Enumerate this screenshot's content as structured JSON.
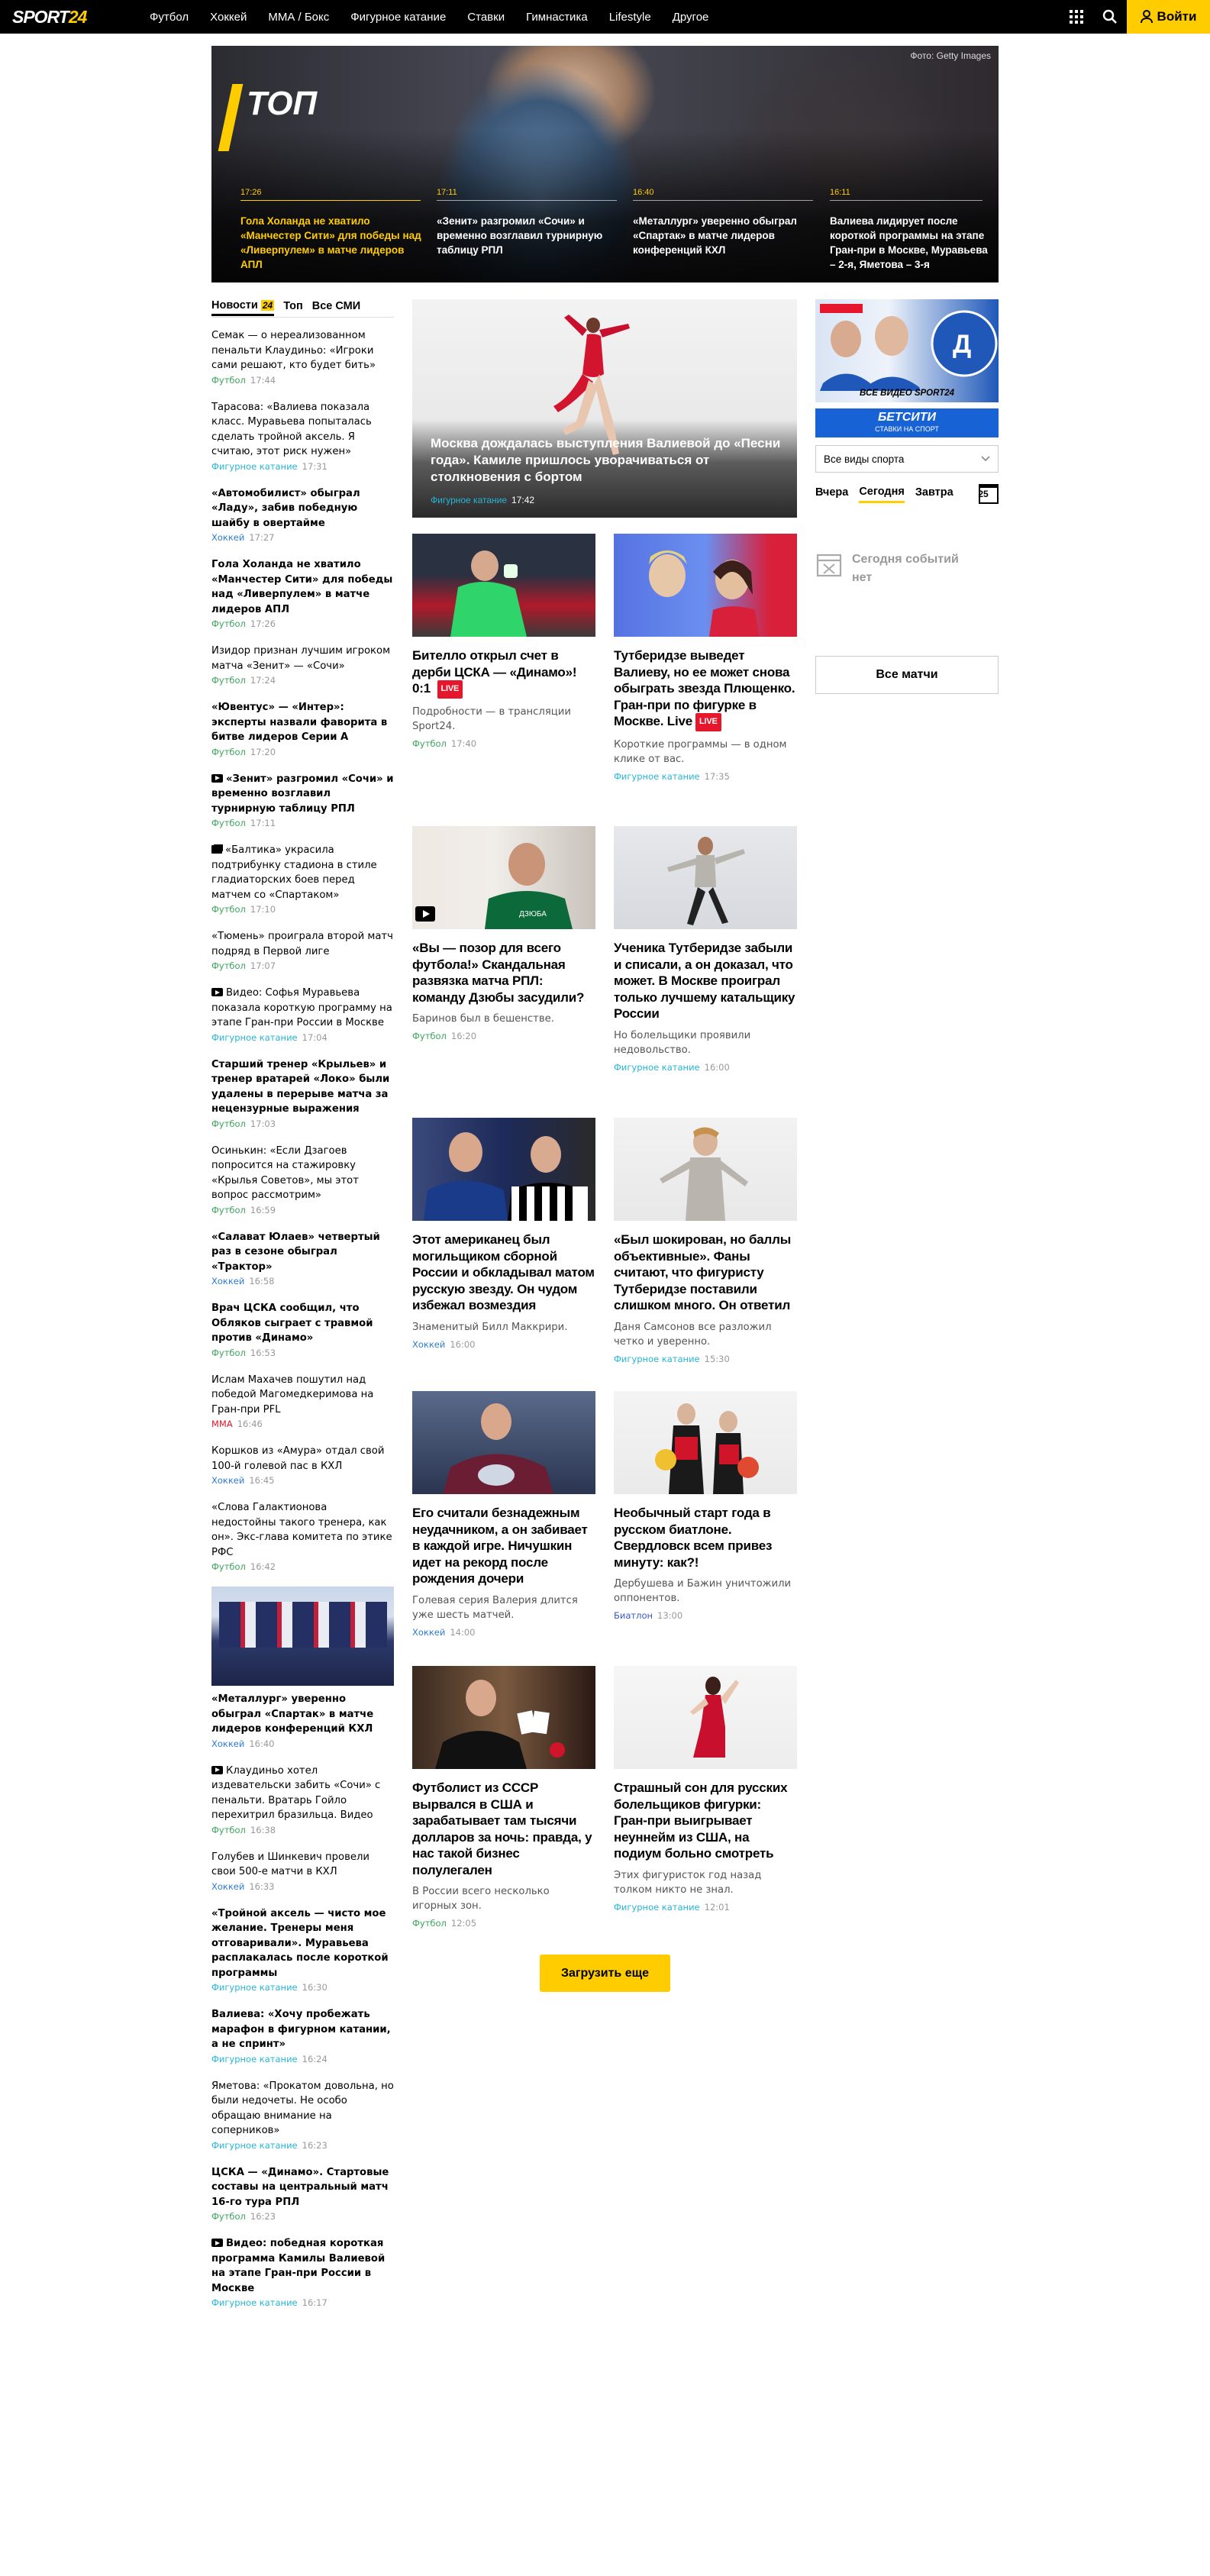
{
  "header": {
    "logo": "SPORT24",
    "nav": [
      "Футбол",
      "Хоккей",
      "ММА / Бокс",
      "Фигурное катание",
      "Ставки",
      "Гимнастика",
      "Lifestyle",
      "Другое"
    ],
    "login": "Войти"
  },
  "colors": {
    "accent": "#ffcc00",
    "football": "#3da35d",
    "hockey": "#2e7bd6",
    "figure": "#27b5d5",
    "mma": "#e6162d",
    "biathlon": "#3858c8"
  },
  "top": {
    "credit": "Фото: Getty Images",
    "title": "ТОП",
    "items": [
      {
        "time": "17:26",
        "title": "Гола Холанда не хватило «Манчестер Сити» для победы над «Ливерпулем» в матче лидеров АПЛ"
      },
      {
        "time": "17:11",
        "title": "«Зенит» разгромил «Сочи» и временно возглавил турнирную таблицу РПЛ"
      },
      {
        "time": "16:40",
        "title": "«Металлург» уверенно обыграл «Спартак» в матче лидеров конференций КХЛ"
      },
      {
        "time": "16:11",
        "title": "Валиева лидирует после короткой программы на этапе Гран-при в Москве, Муравьева – 2-я, Яметова – 3-я"
      }
    ]
  },
  "left": {
    "tabs": [
      "Новости",
      "Топ",
      "Все СМИ"
    ],
    "news": [
      {
        "title": "Семак — о нереализованном пенальти Клаудиньо: «Игроки сами решают, кто будет бить»",
        "cat": "Футбол",
        "time": "17:44",
        "bold": false
      },
      {
        "title": "Тарасова: «Валиева показала класс. Муравьева попыталась сделать тройной аксель. Я считаю, этот риск нужен»",
        "cat": "Фигурное катание",
        "time": "17:31",
        "bold": false
      },
      {
        "title": "«Автомобилист» обыграл «Ладу», забив победную шайбу в овертайме",
        "cat": "Хоккей",
        "time": "17:27",
        "bold": true
      },
      {
        "title": "Гола Холанда не хватило «Манчестер Сити» для победы над «Ливерпулем» в матче лидеров АПЛ",
        "cat": "Футбол",
        "time": "17:26",
        "bold": true
      },
      {
        "title": "Изидор признан лучшим игроком матча «Зенит» — «Сочи»",
        "cat": "Футбол",
        "time": "17:24",
        "bold": false
      },
      {
        "title": "«Ювентус» — «Интер»: эксперты назвали фаворита в битве лидеров Серии А",
        "cat": "Футбол",
        "time": "17:20",
        "bold": true
      },
      {
        "title": "«Зенит» разгромил «Сочи» и временно возглавил турнирную таблицу РПЛ",
        "cat": "Футбол",
        "time": "17:11",
        "bold": true,
        "icon": "video"
      },
      {
        "title": "«Балтика» украсила подтрибунку стадиона в стиле гладиаторских боев перед матчем со «Спартаком»",
        "cat": "Футбол",
        "time": "17:10",
        "bold": false,
        "icon": "gallery"
      },
      {
        "title": "«Тюмень» проиграла второй матч подряд в Первой лиге",
        "cat": "Футбол",
        "time": "17:07",
        "bold": false
      },
      {
        "title": "Видео: Софья Муравьева показала короткую программу на этапе Гран-при России в Москве",
        "cat": "Фигурное катание",
        "time": "17:04",
        "bold": false,
        "icon": "video"
      },
      {
        "title": "Старший тренер «Крыльев» и тренер вратарей «Локо» были удалены в перерыве матча за нецензурные выражения",
        "cat": "Футбол",
        "time": "17:03",
        "bold": true
      },
      {
        "title": "Осинькин: «Если Дзагоев попросится на стажировку «Крылья Советов», мы этот вопрос рассмотрим»",
        "cat": "Футбол",
        "time": "16:59",
        "bold": false
      },
      {
        "title": "«Салават Юлаев» четвертый раз в сезоне обыграл «Трактор»",
        "cat": "Хоккей",
        "time": "16:58",
        "bold": true
      },
      {
        "title": "Врач ЦСКА сообщил, что Обляков сыграет с травмой против «Динамо»",
        "cat": "Футбол",
        "time": "16:53",
        "bold": true
      },
      {
        "title": "Ислам Махачев пошутил над победой Магомедкеримова на Гран-при PFL",
        "cat": "ММА",
        "time": "16:46",
        "bold": false
      },
      {
        "title": "Коршков из «Амура» отдал свой 100-й голевой пас в КХЛ",
        "cat": "Хоккей",
        "time": "16:45",
        "bold": false
      },
      {
        "title": "«Слова Галактионова недостойны такого тренера, как он». Экс-глава комитета по этике РФС",
        "cat": "Футбол",
        "time": "16:42",
        "bold": false
      }
    ],
    "news2": [
      {
        "title": "«Металлург» уверенно обыграл «Спартак» в матче лидеров конференций КХЛ",
        "cat": "Хоккей",
        "time": "16:40",
        "bold": true
      },
      {
        "title": "Клаудиньо хотел издевательски забить «Сочи» с пенальти. Вратарь Гойло перехитрил бразильца. Видео",
        "cat": "Футбол",
        "time": "16:38",
        "bold": false,
        "icon": "video"
      },
      {
        "title": "Голубев и Шинкевич провели свои 500-е матчи в КХЛ",
        "cat": "Хоккей",
        "time": "16:33",
        "bold": false
      },
      {
        "title": "«Тройной аксель — чисто мое желание. Тренеры меня отговаривали». Муравьева расплакалась после короткой программы",
        "cat": "Фигурное катание",
        "time": "16:30",
        "bold": true
      },
      {
        "title": "Валиева: «Хочу пробежать марафон в фигурном катании, а не спринт»",
        "cat": "Фигурное катание",
        "time": "16:24",
        "bold": true
      },
      {
        "title": "Яметова: «Прокатом довольна, но были недочеты. Не особо обращаю внимание на соперников»",
        "cat": "Фигурное катание",
        "time": "16:23",
        "bold": false
      },
      {
        "title": "ЦСКА — «Динамо». Стартовые составы на центральный матч 16-го тура РПЛ",
        "cat": "Футбол",
        "time": "16:23",
        "bold": true
      },
      {
        "title": "Видео: победная короткая программа Камилы Валиевой на этапе Гран-при России в Москве",
        "cat": "Фигурное катание",
        "time": "16:17",
        "bold": true,
        "icon": "video"
      }
    ]
  },
  "hero": {
    "title": "Москва дождалась выступления Валиевой до «Песни года». Камиле пришлось уворачиваться от столкновения с бортом",
    "cat": "Фигурное катание",
    "time": "17:42"
  },
  "cards": [
    {
      "title": "Бителло открыл счет в дерби ЦСКА — «Динамо»! 0:1 LIVE",
      "live": "LIVE",
      "desc": "Подробности — в трансляции Sport24.",
      "cat": "Футбол",
      "time": "17:40"
    },
    {
      "title": "Тутберидзе выведет Валиеву, но ее может снова обыграть звезда Плющенко. Гран-при по фигурке в Москве. Live",
      "live": "LIVE",
      "desc": "Короткие программы — в одном клике от вас.",
      "cat": "Фигурное катание",
      "time": "17:35"
    },
    {
      "title": "«Вы — позор для всего футбола!» Скандальная развязка матча РПЛ: команду Дзюбы засудили?",
      "desc": "Баринов был в бешенстве.",
      "cat": "Футбол",
      "time": "16:20"
    },
    {
      "title": "Ученика Тутберидзе забыли и списали, а он доказал, что может. В Москве проиграл только лучшему катальщику России",
      "desc": "Но болельщики проявили недовольство.",
      "cat": "Фигурное катание",
      "time": "16:00"
    },
    {
      "title": "Этот американец был могильщиком сборной России и обкладывал матом русскую звезду. Он чудом избежал возмездия",
      "desc": "Знаменитый Билл Маккрири.",
      "cat": "Хоккей",
      "time": "16:00"
    },
    {
      "title": "«Был шокирован, но баллы объективные». Фаны считают, что фигуристу Тутберидзе поставили слишком много. Он ответил",
      "desc": "Даня Самсонов все разложил четко и уверенно.",
      "cat": "Фигурное катание",
      "time": "15:30"
    },
    {
      "title": "Его считали безнадежным неудачником, а он забивает в каждой игре. Ничушкин идет на рекорд после рождения дочери",
      "desc": "Голевая серия Валерия длится уже шесть матчей.",
      "cat": "Хоккей",
      "time": "14:00"
    },
    {
      "title": "Необычный старт года в русском биатлоне. Свердловск всем привез минуту: как?!",
      "desc": "Дербушева и Бажин уничтожили оппонентов.",
      "cat": "Биатлон",
      "time": "13:00"
    },
    {
      "title": "Футболист из СССР вырвался в США и зарабатывает там тысячи долларов за ночь: правда, у нас такой бизнес полулегален",
      "desc": "В России всего несколько игорных зон.",
      "cat": "Футбол",
      "time": "12:05"
    },
    {
      "title": "Страшный сон для русских болельщиков фигурки: Гран-при выигрывает неуннейм из США, на подиум больно смотреть",
      "desc": "Этих фигуристок год назад толком никто не знал.",
      "cat": "Фигурное катание",
      "time": "12:01"
    }
  ],
  "load_more": "Загрузить еще",
  "right": {
    "banner_text": "ВСЕ ВИДЕО SPORT24",
    "bet_title": "БЕТСИТИ",
    "bet_sub": "СТАВКИ НА СПОРТ",
    "select": "Все виды спорта",
    "days": [
      "Вчера",
      "Сегодня",
      "Завтра"
    ],
    "cal_day": "25",
    "no_events": "Сегодня событий нет",
    "all_matches": "Все матчи"
  }
}
